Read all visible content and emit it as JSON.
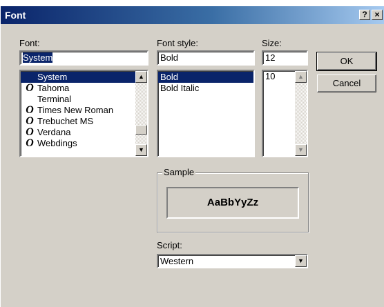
{
  "window": {
    "title": "Font",
    "help_glyph": "?",
    "close_glyph": "×"
  },
  "font": {
    "label": "Font:",
    "value": "System",
    "items": [
      {
        "label": "System",
        "icon": ""
      },
      {
        "label": "Tahoma",
        "icon": "O"
      },
      {
        "label": "Terminal",
        "icon": ""
      },
      {
        "label": "Times New Roman",
        "icon": "O"
      },
      {
        "label": "Trebuchet MS",
        "icon": "O"
      },
      {
        "label": "Verdana",
        "icon": "O"
      },
      {
        "label": "Webdings",
        "icon": "O"
      }
    ],
    "selected_index": 0
  },
  "style": {
    "label": "Font style:",
    "value": "Bold",
    "items": [
      "Bold",
      "Bold Italic"
    ],
    "selected_index": 0
  },
  "size": {
    "label": "Size:",
    "value": "12",
    "items": [
      "10"
    ]
  },
  "buttons": {
    "ok": "OK",
    "cancel": "Cancel"
  },
  "sample": {
    "label": "Sample",
    "text": "AaBbYyZz"
  },
  "script": {
    "label": "Script:",
    "value": "Western"
  },
  "icons": {
    "scroll_up": "▲",
    "scroll_down": "▼",
    "dropdown": "▼",
    "truetype": "truetype-font-icon"
  }
}
